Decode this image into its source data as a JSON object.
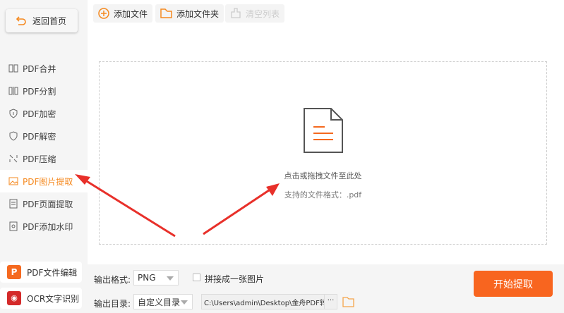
{
  "sidebar": {
    "back_label": "返回首页",
    "items": [
      {
        "label": "PDF合并",
        "icon": "merge-icon"
      },
      {
        "label": "PDF分割",
        "icon": "split-icon"
      },
      {
        "label": "PDF加密",
        "icon": "lock-shield-icon"
      },
      {
        "label": "PDF解密",
        "icon": "unlock-shield-icon"
      },
      {
        "label": "PDF压缩",
        "icon": "compress-icon"
      },
      {
        "label": "PDF图片提取",
        "icon": "image-icon",
        "active": true
      },
      {
        "label": "PDF页面提取",
        "icon": "page-icon"
      },
      {
        "label": "PDF添加水印",
        "icon": "watermark-icon"
      }
    ],
    "apps": [
      {
        "label": "PDF文件编辑"
      },
      {
        "label": "OCR文字识别"
      }
    ]
  },
  "toolbar": {
    "add_file": "添加文件",
    "add_folder": "添加文件夹",
    "clear_list": "清空列表"
  },
  "dropzone": {
    "hint": "点击或拖拽文件至此处",
    "formats": "支持的文件格式：.pdf"
  },
  "options": {
    "format_label": "输出格式:",
    "format_value": "PNG",
    "merge_label": "拼接成一张图片",
    "merge_checked": false,
    "dir_label": "输出目录:",
    "dir_mode": "自定义目录",
    "dir_path": "C:\\Users\\admin\\Desktop\\金舟PDF转换",
    "more": "···"
  },
  "start_button": "开始提取",
  "colors": {
    "accent": "#f5891f",
    "start": "#f8651f",
    "arrow": "#e8302a"
  }
}
